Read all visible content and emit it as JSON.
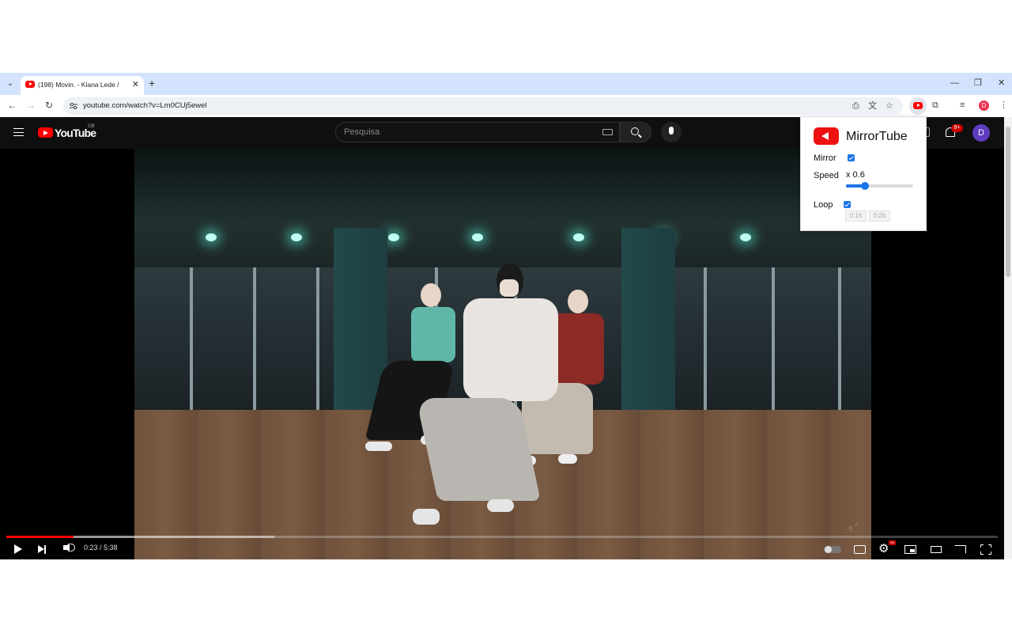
{
  "browser": {
    "tab_title": "(198) Movin. - Kiana Lede /",
    "url": "youtube.com/watch?v=Lm0CUj5ewel"
  },
  "youtube": {
    "wordmark": "YouTube",
    "region": "GB",
    "search_placeholder": "Pesquisa",
    "notification_count": "9+",
    "avatar_letter": "D"
  },
  "player": {
    "time": "0:23 / 5:38",
    "progress_fraction": 0.068,
    "buffered_fraction": 0.27
  },
  "extension": {
    "title": "MirrorTube",
    "mirror_label": "Mirror",
    "mirror_checked": true,
    "speed_label": "Speed",
    "speed_value": "x 0.6",
    "speed_slider_fraction": 0.28,
    "loop_label": "Loop",
    "loop_checked": true,
    "loop_start": "0:16",
    "loop_end": "0:26"
  },
  "colors": {
    "youtube_red": "#ff0000",
    "accent_blue": "#1a73e8",
    "tabstrip": "#d3e3fd"
  }
}
